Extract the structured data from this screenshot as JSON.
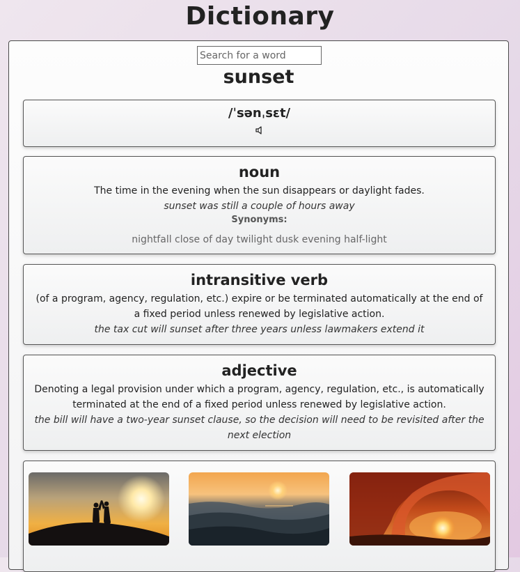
{
  "header": {
    "title": "Dictionary"
  },
  "search": {
    "placeholder": "Search for a word",
    "value": ""
  },
  "word": "sunset",
  "phonetic": {
    "text": "/ˈsənˌsɛt/",
    "audio_icon": "speaker-icon"
  },
  "meanings": [
    {
      "part_of_speech": "noun",
      "definition": "The time in the evening when the sun disappears or daylight fades.",
      "example": "sunset was still a couple of hours away",
      "synonyms_label": "Synonyms:",
      "synonyms": "nightfall close of day twilight dusk evening half-light"
    },
    {
      "part_of_speech": "intransitive verb",
      "definition": "(of a program, agency, regulation, etc.) expire or be terminated automatically at the end of a fixed period unless renewed by legislative action.",
      "example": "the tax cut will sunset after three years unless lawmakers extend it"
    },
    {
      "part_of_speech": "adjective",
      "definition": "Denoting a legal provision under which a program, agency, regulation, etc., is automatically terminated at the end of a fixed period unless renewed by legislative action.",
      "example": "the bill will have a two-year sunset clause, so the decision will need to be revisited after the next election"
    }
  ],
  "images": [
    {
      "name": "sunset-couple-silhouette-image"
    },
    {
      "name": "sunset-ocean-waves-image"
    },
    {
      "name": "sunset-wave-barrel-image"
    }
  ],
  "colors": {
    "background": "#e6d9e8",
    "card_border": "#555555",
    "text": "#222222"
  }
}
